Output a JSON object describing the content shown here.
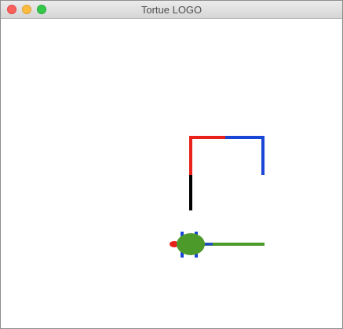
{
  "window": {
    "title": "Tortue LOGO"
  },
  "colors": {
    "red": "#e8221b",
    "blue": "#1a46d6",
    "black": "#000000",
    "green": "#4c9a2a",
    "turtle_body": "#4c9a2a",
    "turtle_feet": "#1a46d6",
    "turtle_head": "#e8221b"
  },
  "turtle": {
    "heading": "left",
    "icon": "turtle-icon"
  },
  "drawing": {
    "segments": [
      {
        "name": "black-segment",
        "color": "black"
      },
      {
        "name": "red-vertical-segment",
        "color": "red"
      },
      {
        "name": "red-horizontal-segment",
        "color": "red"
      },
      {
        "name": "blue-horizontal-segment",
        "color": "blue"
      },
      {
        "name": "blue-vertical-segment",
        "color": "blue"
      },
      {
        "name": "green-segment",
        "color": "green"
      }
    ]
  }
}
